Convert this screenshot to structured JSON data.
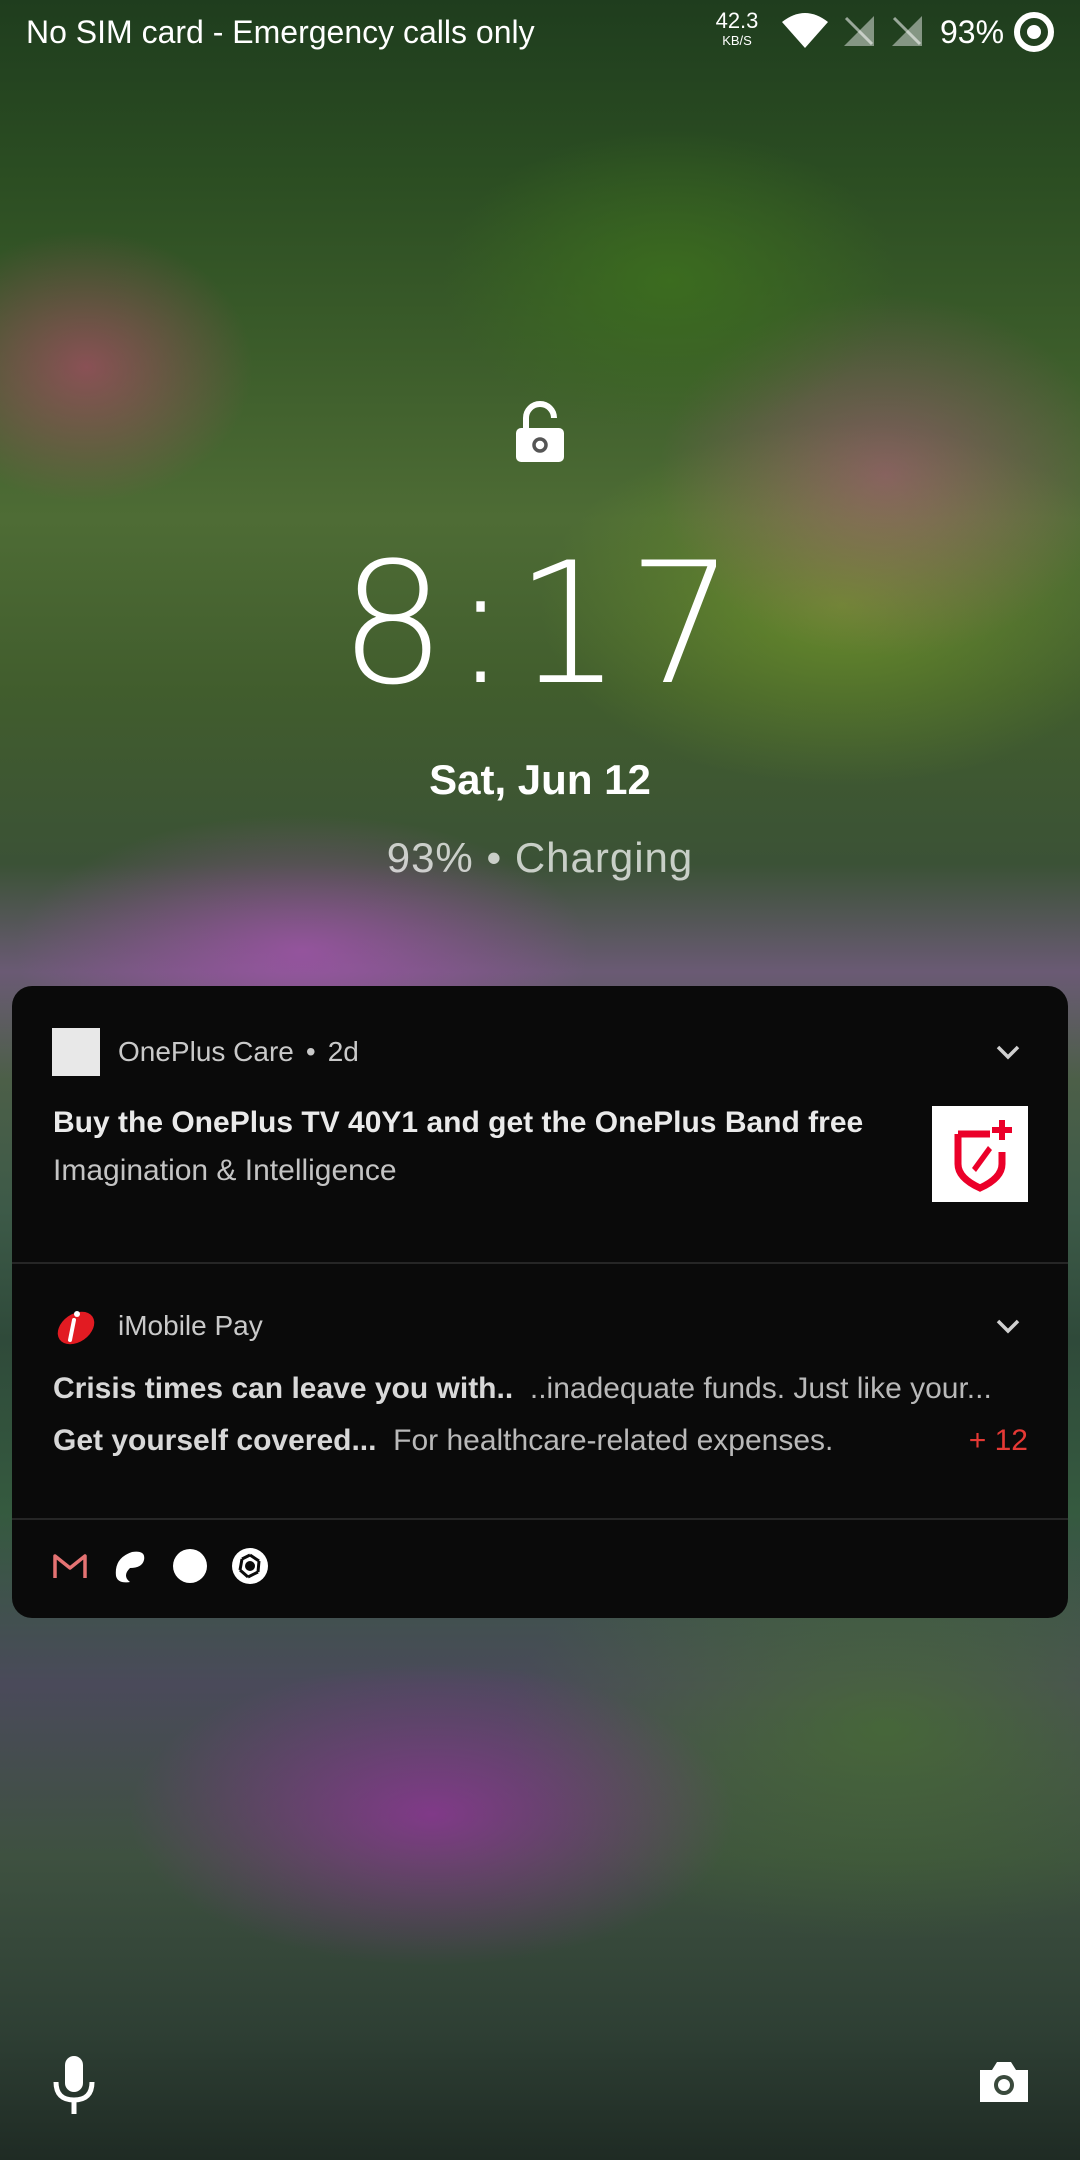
{
  "status_bar": {
    "carrier_text": "No SIM card - Emergency calls only",
    "net_speed_value": "42.3",
    "net_speed_unit": "KB/S",
    "battery_percent": "93%",
    "icons": [
      "wifi-icon",
      "no-sim-icon",
      "no-sim-icon",
      "battery-ring-icon"
    ]
  },
  "lockscreen": {
    "lock_icon": "lock-icon",
    "time": "8:17",
    "date": "Sat, Jun 12",
    "charging_status": "93% • Charging"
  },
  "notifications": [
    {
      "app_name": "OnePlus Care",
      "separator": "•",
      "age": "2d",
      "title": "Buy the OnePlus TV 40Y1 and get the OnePlus Band free",
      "text": "Imagination & Intelligence",
      "thumbnail": "oneplus-care-logo"
    },
    {
      "app_name": "iMobile Pay",
      "lines": [
        {
          "bold": "Crisis times can leave you with..",
          "text": "..inadequate funds. Just like your..."
        },
        {
          "bold": "Get yourself covered...",
          "text": "For healthcare-related expenses."
        }
      ],
      "more_count": "+ 12"
    }
  ],
  "icon_tray": [
    "gmail-icon",
    "airtel-icon",
    "circle-icon",
    "aperture-icon"
  ],
  "shortcuts": {
    "left": "microphone-icon",
    "right": "camera-icon"
  },
  "colors": {
    "card_background": "#0a0a0a",
    "accent_red": "#e53935",
    "oneplus_red": "#eb0029"
  }
}
